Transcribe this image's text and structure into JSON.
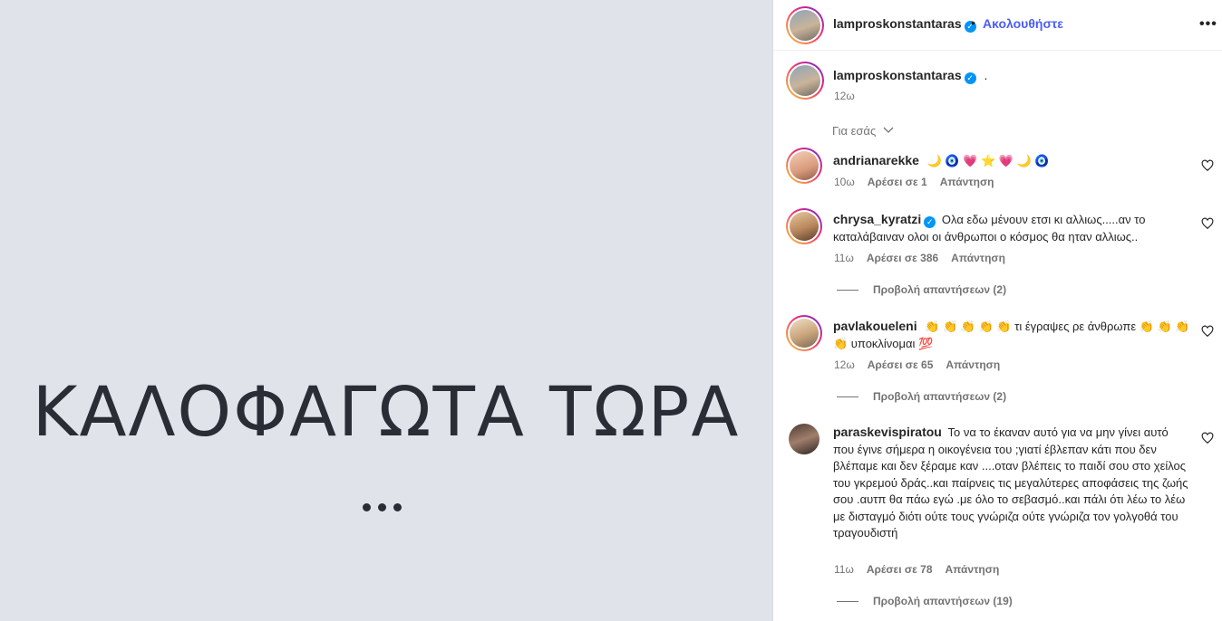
{
  "media": {
    "text": "ΚΑΛΟΦΑΓΩΤΑ ΤΩΡΑ"
  },
  "header": {
    "username": "lamproskonstantaras",
    "separator": "•",
    "follow_label": "Ακολουθήστε",
    "more_icon": "more-horizontal-icon"
  },
  "caption": {
    "username": "lamproskonstantaras",
    "text": ".",
    "time": "12ω"
  },
  "for_you_label": "Για εσάς",
  "comments": [
    {
      "username": "andrianarekke",
      "verified": false,
      "text": "🌙 🧿 💗 ⭐ 💗 🌙 🧿",
      "time": "10ω",
      "likes": "Αρέσει σε 1",
      "reply": "Απάντηση"
    },
    {
      "username": "chrysa_kyratzi",
      "verified": true,
      "text": "Ολα εδω μένουν ετσι κι αλλιως.....αν το καταλάβαιναν ολοι οι άνθρωποι ο κόσμος θα ηταν αλλιως..",
      "time": "11ω",
      "likes": "Αρέσει σε 386",
      "reply": "Απάντηση",
      "view_replies": "Προβολή απαντήσεων (2)"
    },
    {
      "username": "pavlakoueleni",
      "verified": false,
      "text": "👏 👏 👏 👏 👏 τι έγραψες ρε άνθρωπε 👏 👏 👏 👏 υποκλίνομαι 💯",
      "time": "12ω",
      "likes": "Αρέσει σε 65",
      "reply": "Απάντηση",
      "view_replies": "Προβολή απαντήσεων (2)"
    },
    {
      "username": "paraskevispiratou",
      "verified": false,
      "text": "Το να το έκαναν αυτό για να μην γίνει αυτό που έγινε σήμερα η οικογένεια του ;γιατί έβλεπαν κάτι που δεν βλέπαμε και δεν ξέραμε καν ....οταν βλέπεις το παιδί σου στο χείλος του γκρεμού δράς..και παίρνεις τις μεγαλύτερες αποφάσεις της ζωής σου .αυτπ θα πάω εγώ .με όλο το σεβασμό..και πάλι ότι λέω το λέω με δισταγμό διότι ούτε τους γνώριζα ούτε γνώριζα τον γολγοθά του τραγουδιστή",
      "time": "11ω",
      "likes": "Αρέσει σε 78",
      "reply": "Απάντηση",
      "view_replies": "Προβολή απαντήσεων (19)"
    }
  ],
  "colors": {
    "accent": "#4a5df9",
    "verified": "#0095f6",
    "media_bg": "#e0e3e9"
  }
}
